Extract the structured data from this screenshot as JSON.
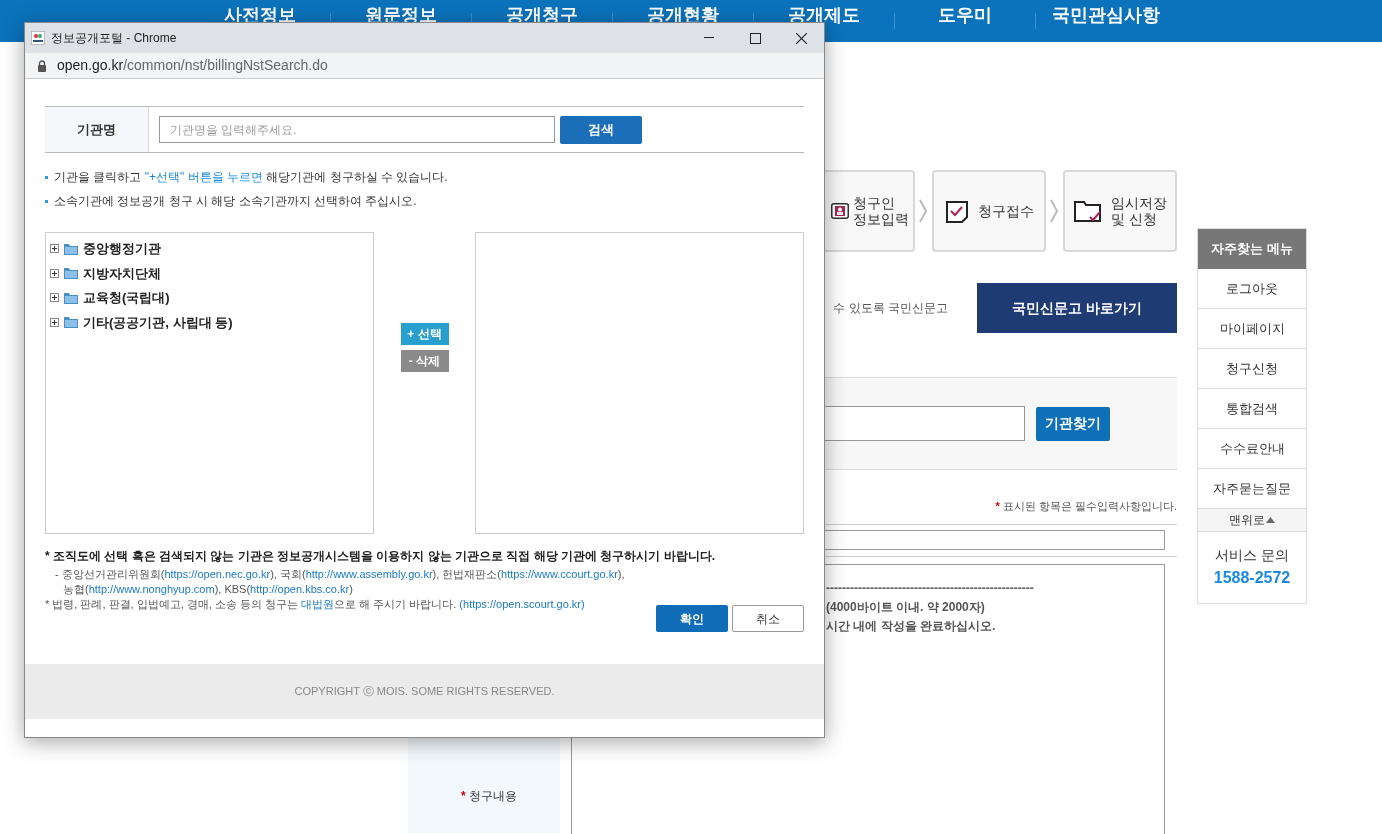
{
  "background_page": {
    "nav": [
      "사전정보",
      "원문정보",
      "공개청구",
      "공개현황",
      "공개제도",
      "도우미",
      "국민관심사항"
    ],
    "steps": [
      {
        "lines": [
          "청구인",
          "정보입력"
        ]
      },
      {
        "lines": [
          "청구접수"
        ]
      },
      {
        "lines": [
          "임시저장",
          "및 신청"
        ]
      }
    ],
    "notice_fragment": "수 있도록 국민신문고",
    "shinmungo_button": "국민신문고 바로가기",
    "org_search_button": "기관찾기",
    "required_note": {
      "mark": "*",
      "text": "표시된 항목은 필수입력사항입니다."
    },
    "content_guide": [
      "----------------------------------------------------",
      "(4000바이트 이내. 약 2000자)",
      "시간 내에 작성을 완료하십시오."
    ],
    "content_label": {
      "mark": "*",
      "text": "청구내용"
    },
    "quick_menu": {
      "title": "자주찾는 메뉴",
      "items": [
        "로그아웃",
        "마이페이지",
        "청구신청",
        "통합검색",
        "수수료안내",
        "자주묻는질문"
      ],
      "top_link": "맨위로",
      "service_label": "서비스 문의",
      "service_phone": "1588-2572"
    }
  },
  "popup": {
    "title": "정보공개포털 - Chrome",
    "url_host": "open.go.kr",
    "url_path": "/common/nst/billingNstSearch.do",
    "search": {
      "label": "기관명",
      "placeholder": "기관명을 입력해주세요.",
      "button": "검색"
    },
    "instructions": [
      [
        {
          "kind": "text",
          "text": "기관을 클릭하고 "
        },
        {
          "kind": "highlight",
          "text": "\"+선택\" 버튼을 누르면"
        },
        {
          "kind": "text",
          "text": " 해당기관에 청구하실 수 있습니다."
        }
      ],
      [
        {
          "kind": "text",
          "text": "소속기관에 정보공개 청구 시 해당 소속기관까지 선택하여 주십시오."
        }
      ]
    ],
    "tree": [
      {
        "label": "중앙행정기관",
        "expanded": false
      },
      {
        "label": "지방자치단체",
        "expanded": false
      },
      {
        "label": "교육청(국립대)",
        "expanded": false
      },
      {
        "label": "기타(공공기관, 사립대 등)",
        "expanded": false
      }
    ],
    "add_button": "+ 선택",
    "remove_button": "- 삭제",
    "notes": [
      {
        "kind": "main",
        "segments": [
          {
            "kind": "text",
            "text": "* 조직도에 선택 혹은 검색되지 않는 기관은 정보공개시스템을 이용하지 않는 기관으로 직접 해당 기관에 청구하시기 바랍니다."
          }
        ]
      },
      {
        "kind": "sub",
        "segments": [
          {
            "kind": "text",
            "text": "- 중앙선거관리위원회("
          },
          {
            "kind": "link",
            "text": "https://open.nec.go.kr"
          },
          {
            "kind": "text",
            "text": "), 국회("
          },
          {
            "kind": "link",
            "text": "http://www.assembly.go.kr"
          },
          {
            "kind": "text",
            "text": "), 헌법재판소("
          },
          {
            "kind": "link",
            "text": "https://www.ccourt.go.kr"
          },
          {
            "kind": "text",
            "text": "),"
          }
        ]
      },
      {
        "kind": "sub2",
        "segments": [
          {
            "kind": "text",
            "text": "농협("
          },
          {
            "kind": "link",
            "text": "http://www.nonghyup.com"
          },
          {
            "kind": "text",
            "text": "), KBS("
          },
          {
            "kind": "link",
            "text": "http://open.kbs.co.kr"
          },
          {
            "kind": "text",
            "text": ")"
          }
        ]
      },
      {
        "kind": "plain",
        "segments": [
          {
            "kind": "text",
            "text": "* 법령, 판례, 판결, 입법예고, 경매, 소송 등의 청구는 "
          },
          {
            "kind": "link",
            "text": "대법원"
          },
          {
            "kind": "text",
            "text": "으로 해 주시기 바랍니다. "
          },
          {
            "kind": "link",
            "text": "(https://open.scourt.go.kr)"
          }
        ]
      }
    ],
    "confirm_button": "확인",
    "cancel_button": "취소",
    "copyright": "COPYRIGHT ⓒ MOIS. SOME RIGHTS RESERVED."
  }
}
